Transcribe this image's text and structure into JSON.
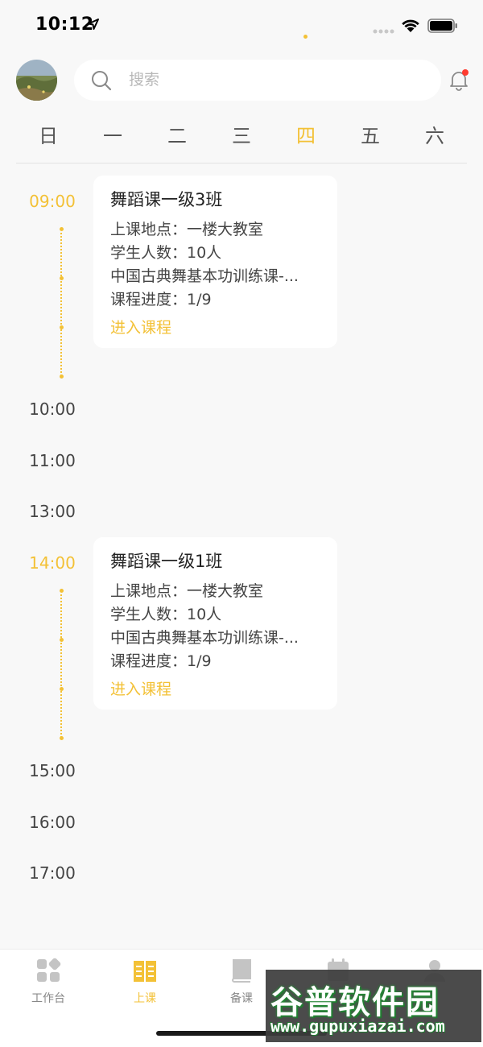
{
  "status_bar": {
    "time": "10:12"
  },
  "search": {
    "placeholder": "搜索"
  },
  "week": {
    "days": [
      "日",
      "一",
      "二",
      "三",
      "四",
      "五",
      "六"
    ],
    "selected": "四"
  },
  "timeline": {
    "times": [
      "09:00",
      "10:00",
      "11:00",
      "13:00",
      "14:00",
      "15:00",
      "16:00",
      "17:00"
    ]
  },
  "courses": [
    {
      "time": "09:00",
      "title": "舞蹈课一级3班",
      "location": "上课地点：一楼大教室",
      "students": "学生人数：10人",
      "course_name": "中国古典舞基本功训练课-...",
      "progress": "课程进度：1/9",
      "action": "进入课程"
    },
    {
      "time": "14:00",
      "title": "舞蹈课一级1班",
      "location": "上课地点：一楼大教室",
      "students": "学生人数：10人",
      "course_name": "中国古典舞基本功训练课-...",
      "progress": "课程进度：1/9",
      "action": "进入课程"
    }
  ],
  "tab_bar": {
    "tabs": [
      {
        "label": "工作台",
        "icon": "grid-icon"
      },
      {
        "label": "上课",
        "icon": "book-open-icon"
      },
      {
        "label": "备课",
        "icon": "notebook-icon"
      },
      {
        "label": "",
        "icon": "calendar-icon"
      },
      {
        "label": "",
        "icon": "person-icon"
      }
    ],
    "active": "上课"
  },
  "watermark": {
    "brand": "谷普软件园",
    "url": "www.gupuxiazai.com"
  },
  "colors": {
    "accent": "#f3c136",
    "notification": "#ff3b30"
  }
}
